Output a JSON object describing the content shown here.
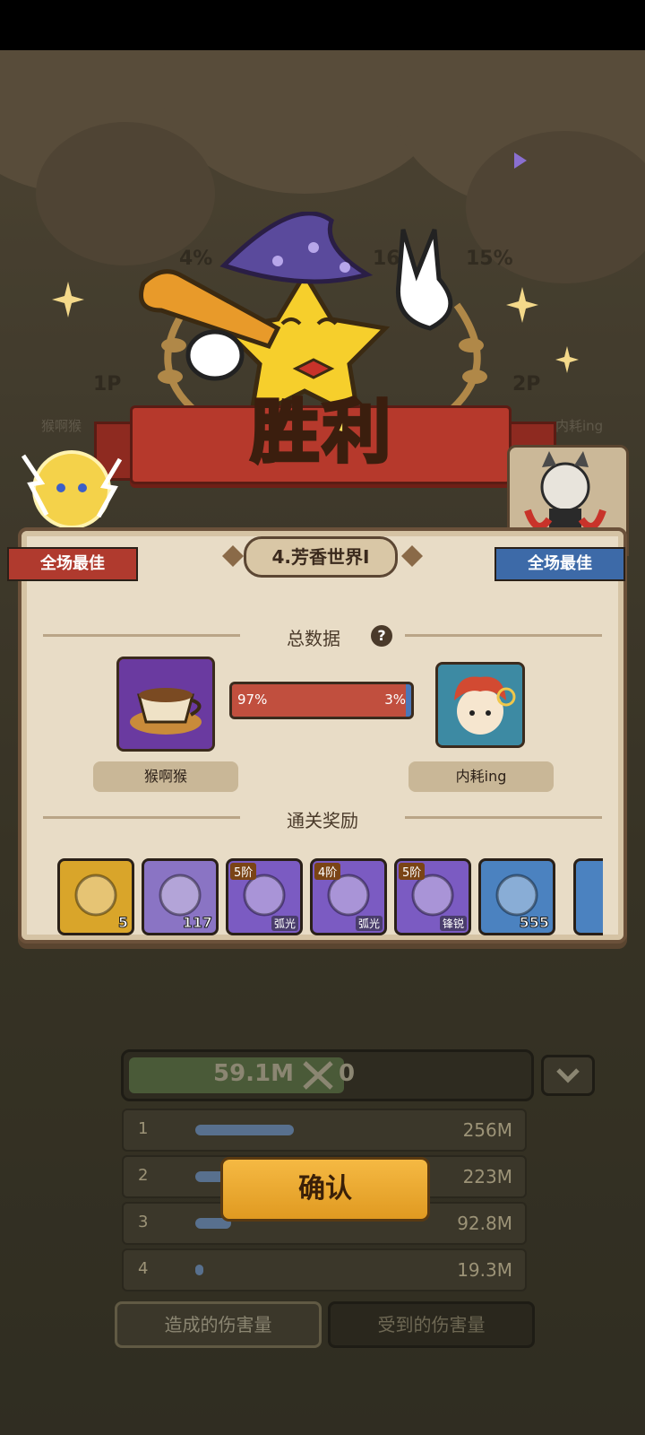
{
  "banner": {
    "title": "胜利"
  },
  "background_hud": {
    "left_percent": "4%",
    "mid_left": "16",
    "mid_right": "161",
    "right_percent": "15%",
    "p1_label": "1P",
    "p2_label": "2P",
    "p1_name": "猴啊猴",
    "p2_name": "内耗ing"
  },
  "panel": {
    "stage_title": "4.芳香世界Ⅰ",
    "mvp_left": "全场最佳",
    "mvp_right": "全场最佳",
    "total_data_title": "总数据",
    "help_glyph": "?",
    "rewards_title": "通关奖励"
  },
  "players": {
    "left_name": "猴啊猴",
    "right_name": "内耗ing",
    "left_share_label": "97%",
    "right_share_label": "3%",
    "left_share": 0.97
  },
  "rewards": [
    {
      "count": "5",
      "tier": "",
      "tag": "",
      "color": "#d9a52a"
    },
    {
      "count": "117",
      "tier": "",
      "tag": "",
      "color": "#8a74c4"
    },
    {
      "count": "",
      "tier": "5阶",
      "tag": "弧光",
      "color": "#7b5bc2"
    },
    {
      "count": "",
      "tier": "4阶",
      "tag": "弧光",
      "color": "#7b5bc2"
    },
    {
      "count": "",
      "tier": "5阶",
      "tag": "锋锐",
      "color": "#7b5bc2"
    },
    {
      "count": "555",
      "tier": "",
      "tag": "",
      "color": "#4b82c0"
    }
  ],
  "damage_summary": {
    "dealt": "59.1M",
    "taken": "0"
  },
  "ranking": [
    {
      "rank": "1",
      "value": "256M",
      "fill": 1.0
    },
    {
      "rank": "2",
      "value": "223M",
      "fill": 0.87
    },
    {
      "rank": "3",
      "value": "92.8M",
      "fill": 0.36
    },
    {
      "rank": "4",
      "value": "19.3M",
      "fill": 0.08
    }
  ],
  "confirm_label": "确认",
  "tabs": {
    "dealt": "造成的伤害量",
    "taken": "受到的伤害量"
  }
}
